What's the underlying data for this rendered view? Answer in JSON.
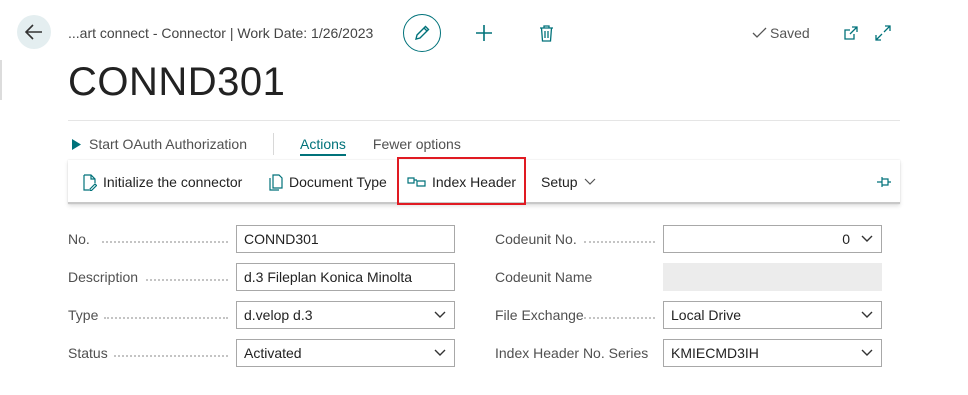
{
  "header": {
    "breadcrumb": "...art connect - Connector | Work Date: 1/26/2023",
    "saved_label": "Saved",
    "title": "CONND301"
  },
  "actions_bar": {
    "start_oauth": "Start OAuth Authorization",
    "actions_tab": "Actions",
    "fewer_options": "Fewer options"
  },
  "ribbon": {
    "initialize": "Initialize the connector",
    "document_type": "Document Type",
    "index_header": "Index Header",
    "setup": "Setup"
  },
  "form": {
    "no": {
      "label": "No.",
      "value": "CONND301"
    },
    "description": {
      "label": "Description",
      "value": "d.3 Fileplan Konica Minolta"
    },
    "type": {
      "label": "Type",
      "value": "d.velop d.3"
    },
    "status": {
      "label": "Status",
      "value": "Activated"
    },
    "codeunit_no": {
      "label": "Codeunit No.",
      "value": "0"
    },
    "codeunit_name": {
      "label": "Codeunit Name",
      "value": ""
    },
    "file_exchange": {
      "label": "File Exchange",
      "value": "Local Drive"
    },
    "index_header_no_series": {
      "label": "Index Header No. Series",
      "value": "KMIECMD3IH"
    }
  },
  "colors": {
    "accent": "#00727a",
    "highlight": "#e01a22"
  },
  "icons": [
    "back-arrow-icon",
    "edit-pencil-icon",
    "plus-icon",
    "trash-icon",
    "checkmark-icon",
    "open-in-new-icon",
    "expand-icon",
    "play-icon",
    "document-edit-icon",
    "document-icon",
    "index-header-icon",
    "chevron-down-icon",
    "pin-icon"
  ]
}
